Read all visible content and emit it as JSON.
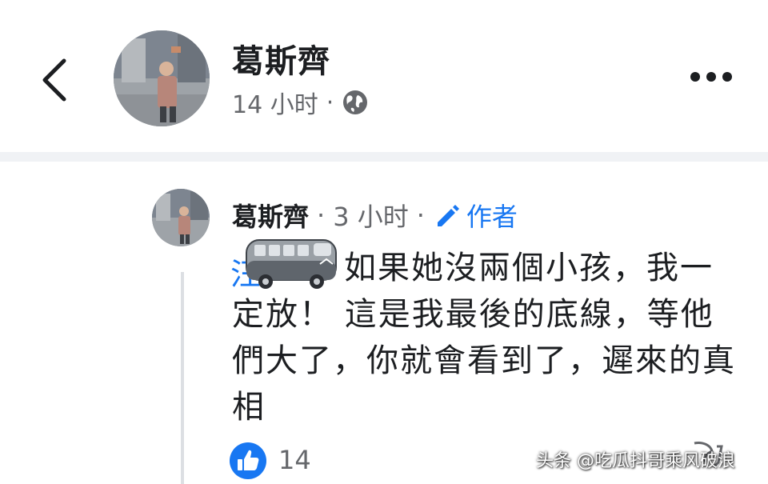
{
  "post": {
    "author": "葛斯齊",
    "time": "14 小时",
    "separator": "·",
    "visibility_icon": "globe-icon"
  },
  "comment": {
    "author": "葛斯齊",
    "time": "3 小时",
    "separator": "·",
    "badge_label": "作者",
    "mention": "汪",
    "text": "如果她沒兩個小孩，我一定放！ 這是我最後的底線，等他們大了，你就會看到了，遲來的真相",
    "likes": "14"
  },
  "icons": {
    "back": "chevron-left-icon",
    "more": "more-horizontal-icon",
    "pencil": "pencil-icon",
    "like": "thumbs-up-icon"
  },
  "colors": {
    "accent": "#1877f2",
    "secondary_text": "#65676b",
    "divider": "#f0f2f5"
  },
  "watermark": "头条 @吃瓜抖哥乘风破浪"
}
